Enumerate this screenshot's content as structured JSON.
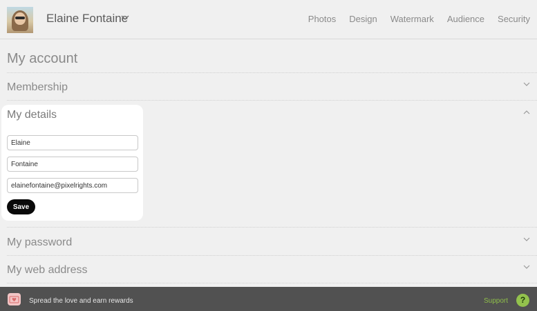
{
  "header": {
    "user_name": "Elaine Fontaine",
    "nav": [
      "Photos",
      "Design",
      "Watermark",
      "Audience",
      "Security"
    ]
  },
  "page": {
    "title": "My account"
  },
  "sections": {
    "membership": "Membership",
    "details": "My details",
    "password": "My password",
    "web_address": "My web address"
  },
  "details_form": {
    "first_name": "Elaine",
    "last_name": "Fontaine",
    "email": "elainefontaine@pixelrights.com",
    "save_label": "Save"
  },
  "footer": {
    "promo_text": "Spread the love and earn rewards",
    "support_label": "Support",
    "help_label": "?"
  },
  "colors": {
    "background": "#f0f0f0",
    "footer": "#515151",
    "accent_green": "#93c24d",
    "button": "#0a0a0a"
  },
  "icons": {
    "user_menu": "chevron-down-icon",
    "collapsed": "chevron-down-icon",
    "expanded": "chevron-up-icon",
    "promo": "gift-heart-icon",
    "help": "question-icon"
  }
}
